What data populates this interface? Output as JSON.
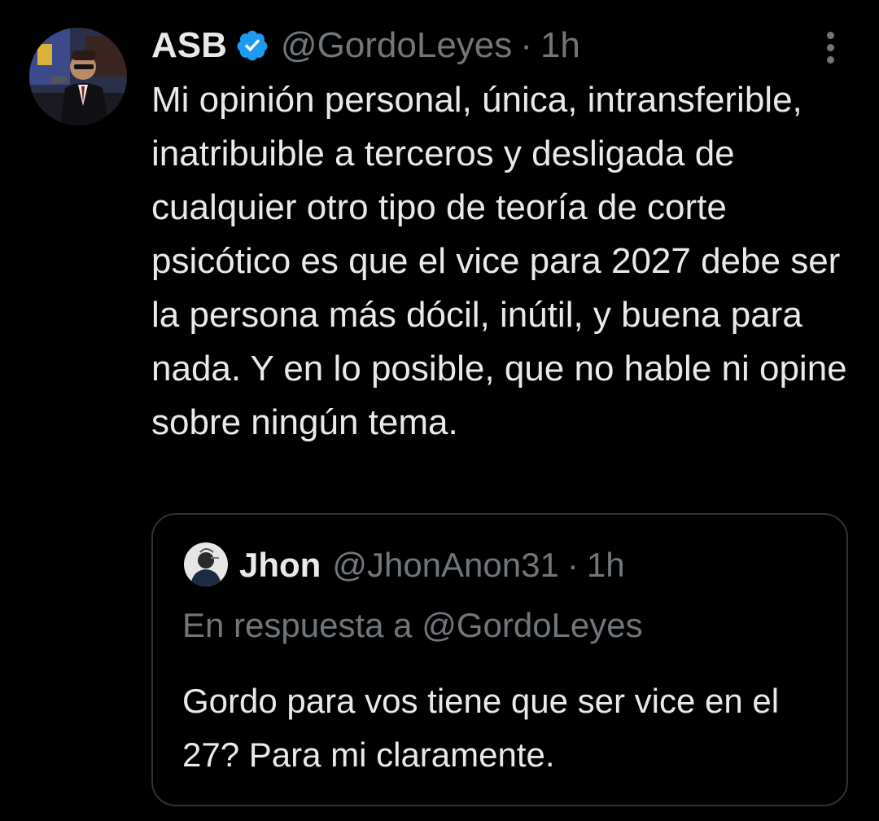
{
  "tweet": {
    "author_name": "ASB",
    "handle": "@GordoLeyes",
    "separator": "·",
    "time": "1h",
    "text": "Mi opinión personal, única, intransferible, inatribuible a terceros y desligada de cualquier otro tipo de teoría de corte psicótico es que el vice para 2027 debe ser la persona más dócil, inútil, y buena para nada. Y en lo posible, que no hable ni opine sobre ningún tema.",
    "verified_icon": "verified-badge-icon",
    "more_icon": "more-options-icon"
  },
  "quote": {
    "author_name": "Jhon",
    "handle": "@JhonAnon31",
    "separator": "·",
    "time": "1h",
    "reply_prefix": "En respuesta a",
    "reply_handle": "@GordoLeyes",
    "text": "Gordo para vos tiene que ser vice en el 27? Para mi claramente."
  },
  "colors": {
    "background": "#000000",
    "primary_text": "#e7e9ea",
    "secondary_text": "#71767b",
    "verified_blue": "#1d9bf0",
    "border": "#2f3336"
  }
}
